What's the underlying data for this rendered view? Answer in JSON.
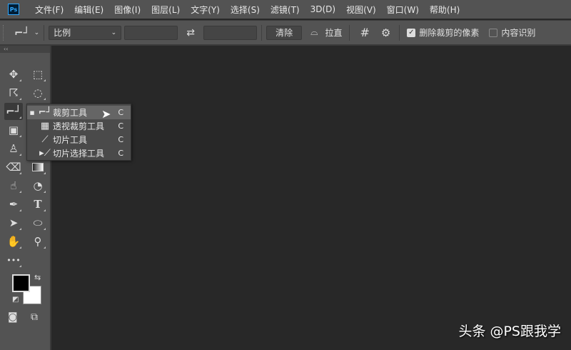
{
  "app": {
    "logo": "Ps"
  },
  "menu": [
    "文件(F)",
    "编辑(E)",
    "图像(I)",
    "图层(L)",
    "文字(Y)",
    "选择(S)",
    "滤镜(T)",
    "3D(D)",
    "视图(V)",
    "窗口(W)",
    "帮助(H)"
  ],
  "options": {
    "ratio_select": "比例",
    "width_value": "",
    "height_value": "",
    "clear_label": "清除",
    "straighten_label": "拉直",
    "delete_cropped_label": "删除裁剪的像素",
    "delete_cropped_checked": true,
    "content_aware_label": "内容识别",
    "content_aware_checked": false
  },
  "flyout": [
    {
      "label": "裁剪工具",
      "key": "C",
      "selected": true
    },
    {
      "label": "透视裁剪工具",
      "key": "C"
    },
    {
      "label": "切片工具",
      "key": "C"
    },
    {
      "label": "切片选择工具",
      "key": "C"
    }
  ],
  "toolpanel": {
    "collapse": "‹‹",
    "more_tools": "•••"
  },
  "colors": {
    "foreground": "#000000",
    "background": "#ffffff"
  },
  "watermark": "头条 @PS跟我学"
}
